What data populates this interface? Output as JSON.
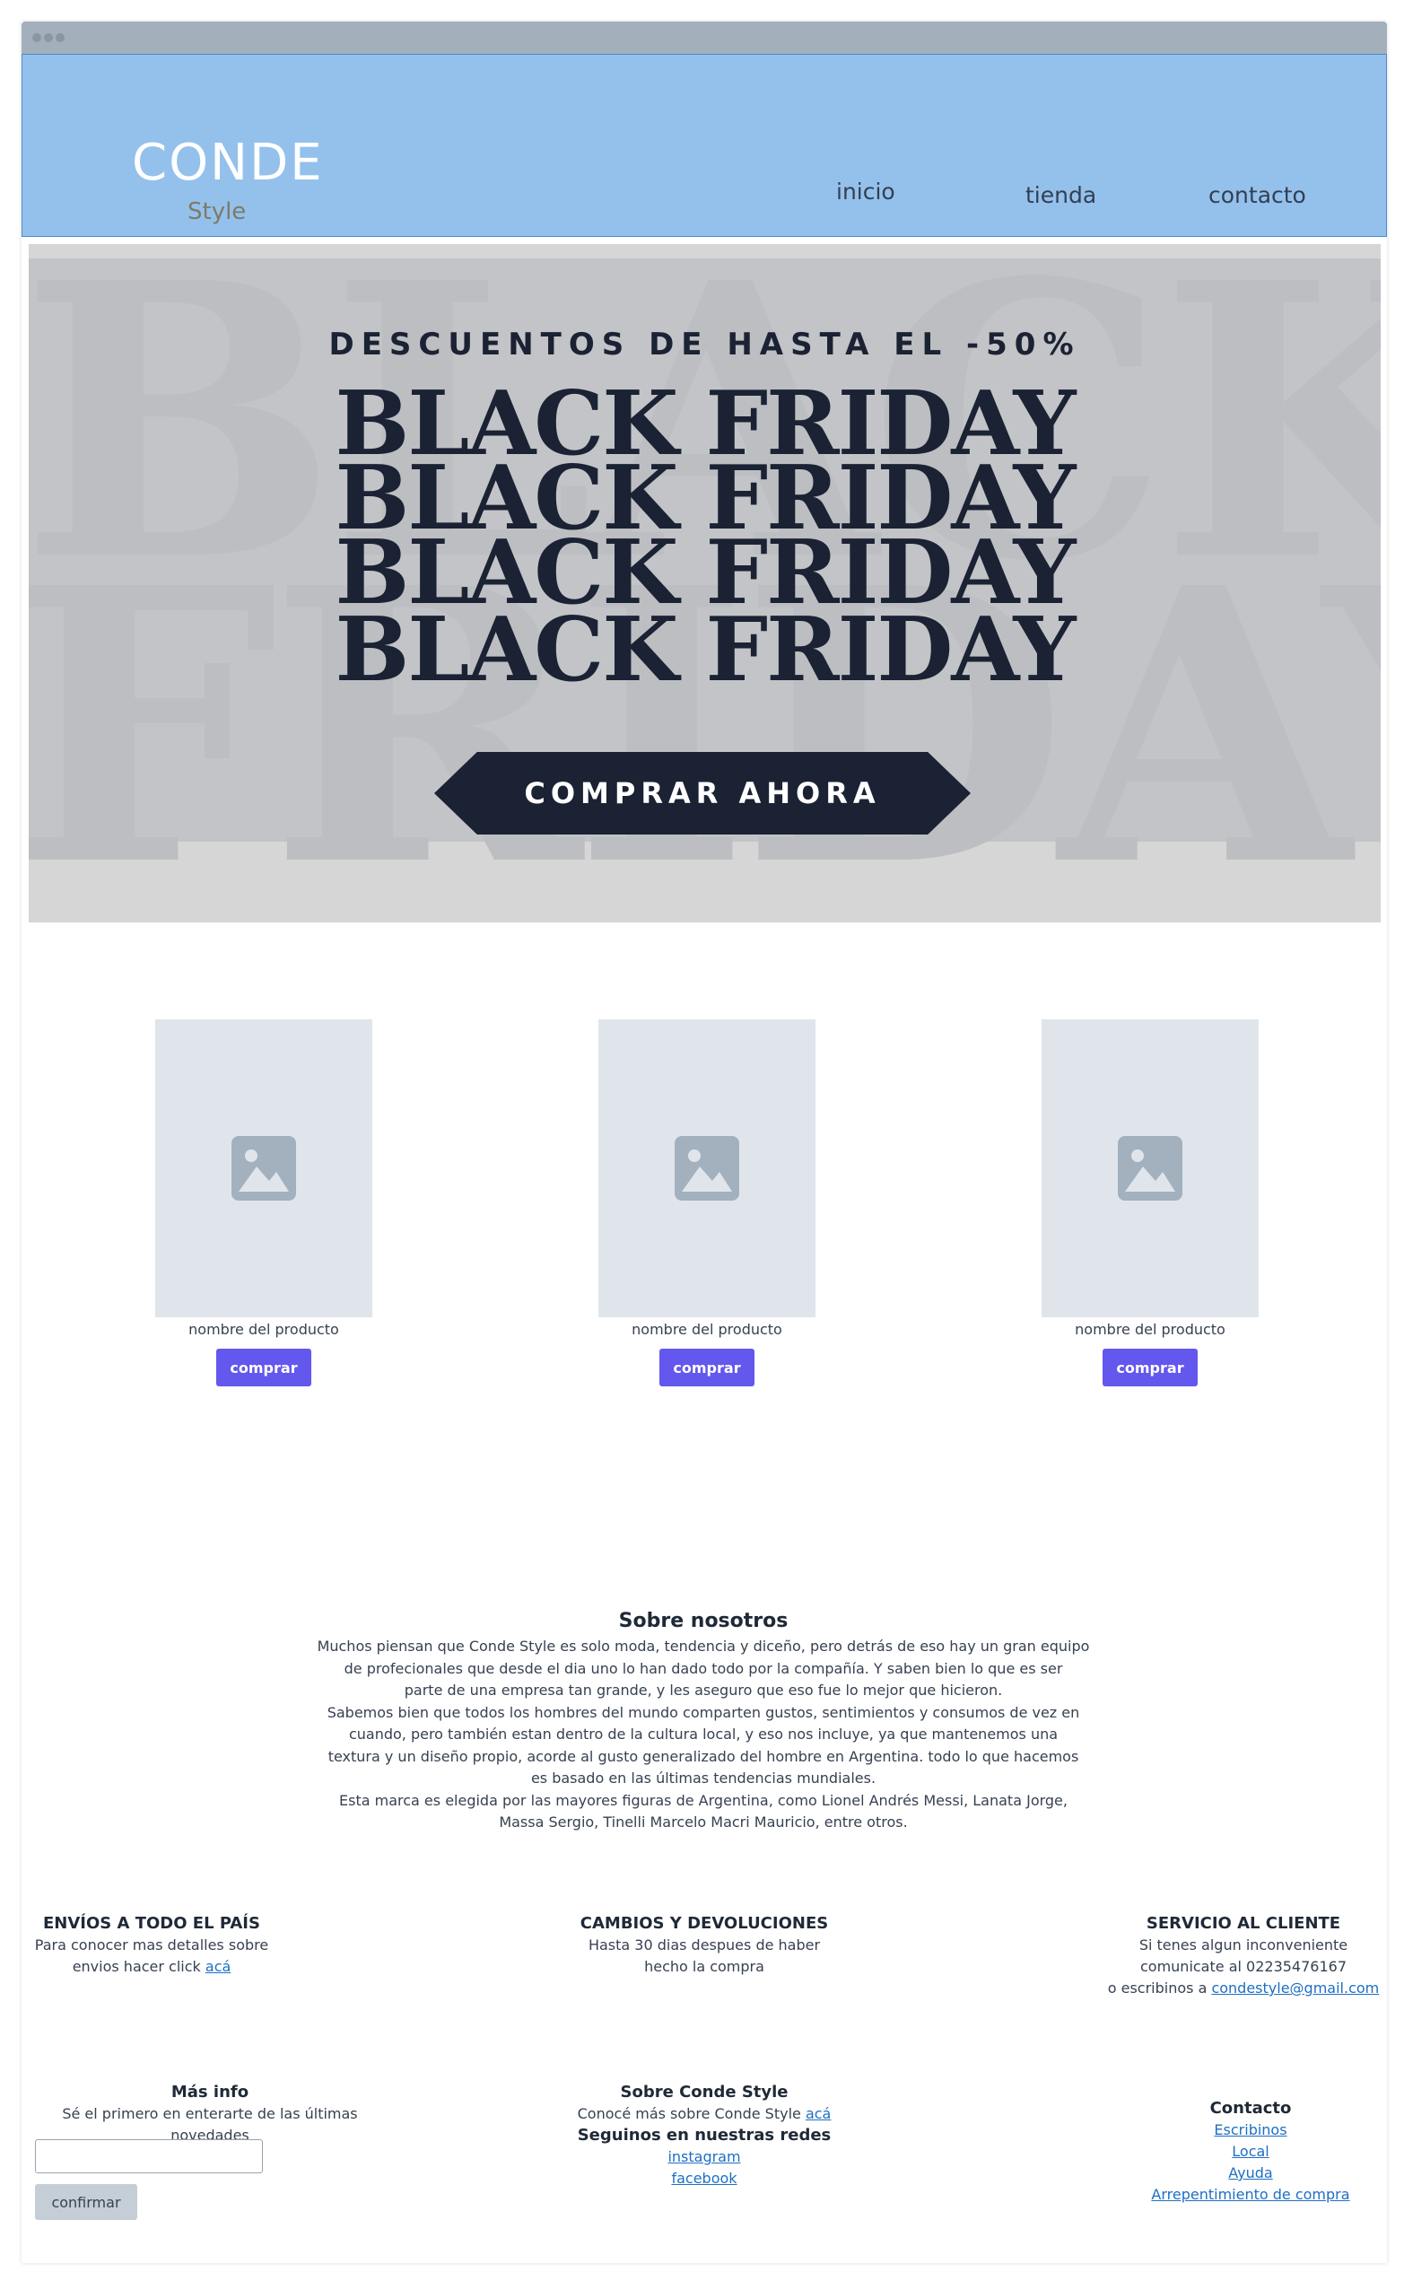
{
  "brand": {
    "name": "CONDE",
    "tagline": "Style"
  },
  "nav": {
    "items": [
      "inicio",
      "tienda",
      "contacto"
    ]
  },
  "banner": {
    "promo": "DESCUENTOS DE HASTA EL -50%",
    "headline": "BLACK FRIDAY",
    "background_words": [
      "BLACK",
      "FRIDAY"
    ],
    "cta": "COMPRAR AHORA"
  },
  "products": [
    {
      "name": "nombre del producto",
      "button": "comprar"
    },
    {
      "name": "nombre del producto",
      "button": "comprar"
    },
    {
      "name": "nombre del producto",
      "button": "comprar"
    }
  ],
  "about": {
    "title": "Sobre nosotros",
    "lines": [
      "Muchos piensan que Conde Style es solo moda, tendencia y diceño, pero detrás de eso hay un gran equipo",
      "de profecionales que desde el dia uno lo han dado todo por la compañía. Y saben bien lo que es ser",
      "parte de una empresa tan grande, y les aseguro que eso fue lo mejor que hicieron.",
      "Sabemos bien que todos los hombres del mundo comparten gustos, sentimientos y consumos de vez en",
      "cuando, pero también estan dentro de la cultura local, y eso nos incluye, ya que mantenemos una",
      "textura y un diseño propio, acorde al gusto generalizado del hombre en Argentina. todo lo que hacemos",
      "es basado en las últimas tendencias mundiales.",
      "Esta marca es elegida por las mayores figuras de Argentina, como Lionel Andrés Messi, Lanata Jorge,",
      "Massa Sergio, Tinelli Marcelo Macri Mauricio, entre otros."
    ]
  },
  "features": {
    "shipping": {
      "title": "ENVÍOS A TODO EL PAÍS",
      "line1": "Para conocer mas detalles sobre",
      "line2": "envios hacer click ",
      "link": "acá"
    },
    "returns": {
      "title": "CAMBIOS Y DEVOLUCIONES",
      "line1": "Hasta 30 dias despues de haber",
      "line2": "hecho la compra"
    },
    "service": {
      "title": "SERVICIO AL CLIENTE",
      "line1": "Si tenes algun inconveniente",
      "line2": "comunicate al 02235476167",
      "line3": "o escribinos a ",
      "email": "condestyle@gmail.com"
    }
  },
  "footer": {
    "more": {
      "title": "Más info",
      "text": "Sé el primero en enterarte de las últimas novedades",
      "input_placeholder": "",
      "button": "confirmar"
    },
    "about": {
      "title": "Sobre Conde Style",
      "text": "Conocé más sobre Conde Style ",
      "link": "acá",
      "social_title": "Seguinos en nuestras redes",
      "instagram": "instagram",
      "facebook": "facebook"
    },
    "contact": {
      "title": "Contacto",
      "links": [
        "Escribinos",
        "Local",
        "Ayuda",
        "Arrepentimiento de compra"
      ]
    }
  }
}
